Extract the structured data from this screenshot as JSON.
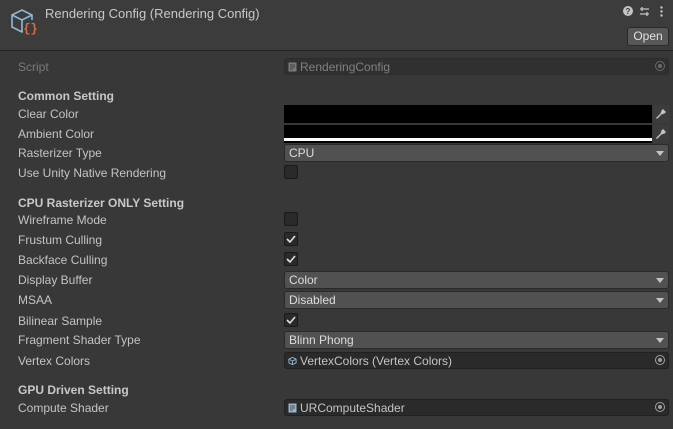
{
  "header": {
    "title": "Rendering Config (Rendering Config)",
    "open_label": "Open"
  },
  "script": {
    "label": "Script",
    "value": "RenderingConfig"
  },
  "common": {
    "section_title": "Common Setting",
    "clear_color_label": "Clear Color",
    "clear_color": "#000000",
    "ambient_color_label": "Ambient Color",
    "ambient_color": "#000000",
    "rasterizer_type_label": "Rasterizer Type",
    "rasterizer_type": "CPU",
    "native_rendering_label": "Use Unity Native Rendering",
    "native_rendering": false
  },
  "cpu": {
    "section_title": "CPU Rasterizer ONLY Setting",
    "wireframe_label": "Wireframe Mode",
    "wireframe": false,
    "frustum_label": "Frustum Culling",
    "frustum": true,
    "backface_label": "Backface Culling",
    "backface": true,
    "display_buffer_label": "Display Buffer",
    "display_buffer": "Color",
    "msaa_label": "MSAA",
    "msaa": "Disabled",
    "bilinear_label": "Bilinear Sample",
    "bilinear": true,
    "fragment_shader_label": "Fragment Shader Type",
    "fragment_shader": "Blinn Phong",
    "vertex_colors_label": "Vertex Colors",
    "vertex_colors": "VertexColors (Vertex Colors)"
  },
  "gpu": {
    "section_title": "GPU Driven Setting",
    "compute_shader_label": "Compute Shader",
    "compute_shader": "URComputeShader"
  },
  "colors": {
    "background": "#383838",
    "field": "#2a2a2a",
    "dropdown": "#515151"
  }
}
